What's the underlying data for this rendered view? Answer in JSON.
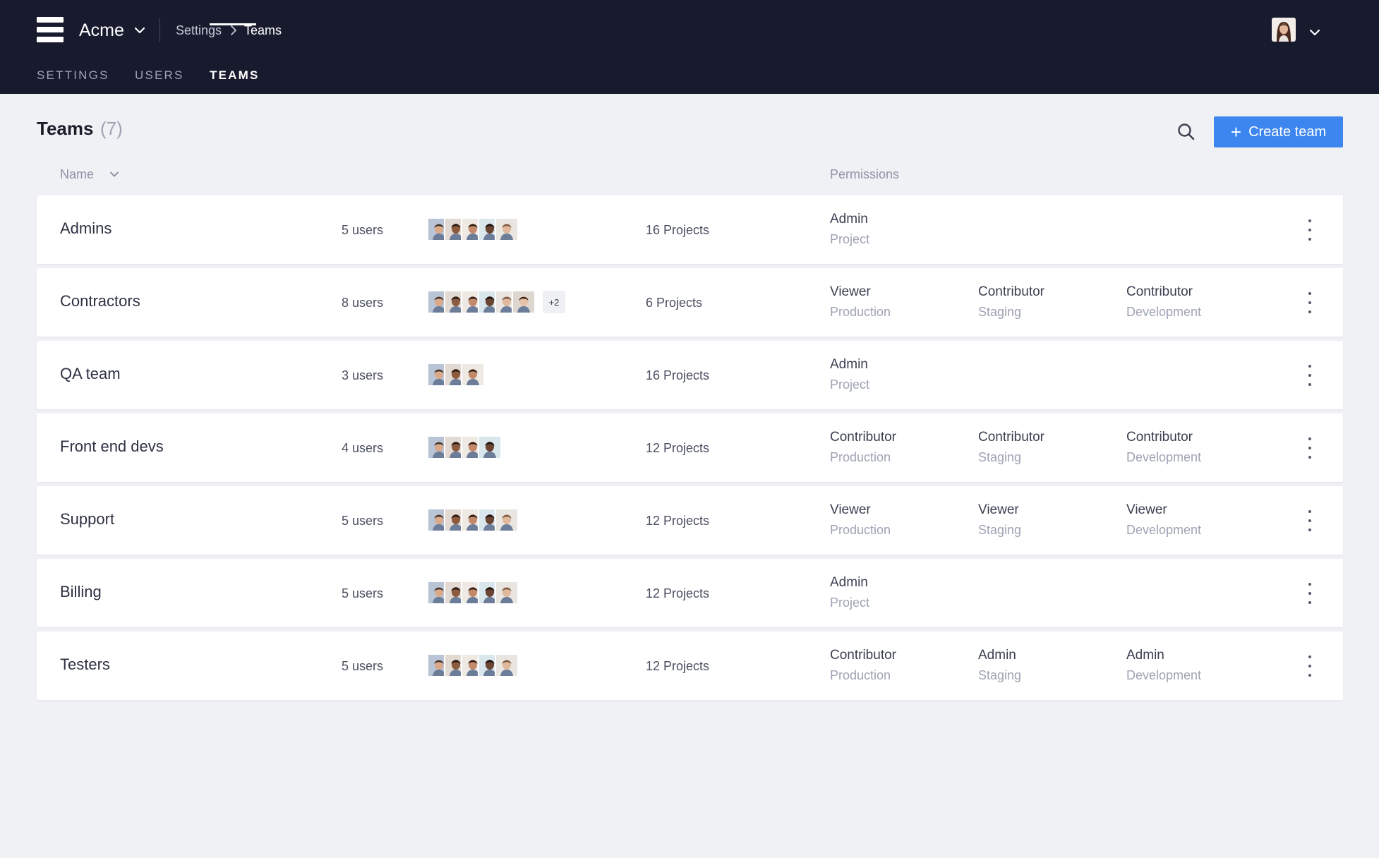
{
  "header": {
    "org_name": "Acme",
    "breadcrumb": {
      "parent": "Settings",
      "current": "Teams"
    },
    "user_avatar": "user-avatar",
    "tabs": [
      {
        "label": "SETTINGS",
        "active": false
      },
      {
        "label": "USERS",
        "active": false
      },
      {
        "label": "TEAMS",
        "active": true
      }
    ]
  },
  "page": {
    "title": "Teams",
    "count": "(7)",
    "create_button": "Create team",
    "columns": {
      "name": "Name",
      "permissions": "Permissions"
    }
  },
  "colors": {
    "header_bg": "#181a2e",
    "page_bg": "#f0f1f5",
    "accent": "#3d86f0",
    "row_bg": "#ffffff"
  },
  "teams": [
    {
      "name": "Admins",
      "users": "5 users",
      "projects": "16 Projects",
      "avatar_count": 5,
      "more": "",
      "permissions": [
        {
          "role": "Admin",
          "env": "Project"
        }
      ]
    },
    {
      "name": "Contractors",
      "users": "8 users",
      "projects": "6 Projects",
      "avatar_count": 6,
      "more": "+2",
      "permissions": [
        {
          "role": "Viewer",
          "env": "Production"
        },
        {
          "role": "Contributor",
          "env": "Staging"
        },
        {
          "role": "Contributor",
          "env": "Development"
        }
      ]
    },
    {
      "name": "QA team",
      "users": "3 users",
      "projects": "16 Projects",
      "avatar_count": 3,
      "more": "",
      "permissions": [
        {
          "role": "Admin",
          "env": "Project"
        }
      ]
    },
    {
      "name": "Front end devs",
      "users": "4 users",
      "projects": "12 Projects",
      "avatar_count": 4,
      "more": "",
      "permissions": [
        {
          "role": "Contributor",
          "env": "Production"
        },
        {
          "role": "Contributor",
          "env": "Staging"
        },
        {
          "role": "Contributor",
          "env": "Development"
        }
      ]
    },
    {
      "name": "Support",
      "users": "5 users",
      "projects": "12 Projects",
      "avatar_count": 5,
      "more": "",
      "permissions": [
        {
          "role": "Viewer",
          "env": "Production"
        },
        {
          "role": "Viewer",
          "env": "Staging"
        },
        {
          "role": "Viewer",
          "env": "Development"
        }
      ]
    },
    {
      "name": "Billing",
      "users": "5 users",
      "projects": "12 Projects",
      "avatar_count": 5,
      "more": "",
      "permissions": [
        {
          "role": "Admin",
          "env": "Project"
        }
      ]
    },
    {
      "name": "Testers",
      "users": "5 users",
      "projects": "12 Projects",
      "avatar_count": 5,
      "more": "",
      "permissions": [
        {
          "role": "Contributor",
          "env": "Production"
        },
        {
          "role": "Admin",
          "env": "Staging"
        },
        {
          "role": "Admin",
          "env": "Development"
        }
      ]
    }
  ]
}
